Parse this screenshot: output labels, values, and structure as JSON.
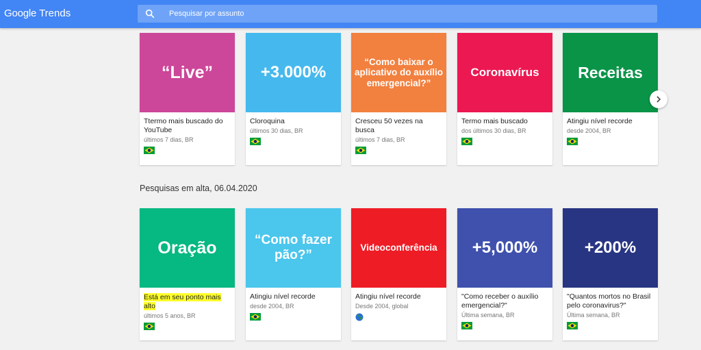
{
  "header": {
    "logo_google": "Google",
    "logo_trends": "Trends",
    "search_placeholder": "Pesquisar por assunto"
  },
  "year_in_search": {
    "cards": [
      {
        "tile_text": "“Live”",
        "color": "#cc4699",
        "description": "Ttermo mais buscado do YouTube",
        "meta": "últimos 7 dias, BR",
        "flag": "brazil-flag-icon"
      },
      {
        "tile_text": "+3.000%",
        "color": "#45b9ee",
        "description": "Cloroquina",
        "meta": "últimos 30 dias, BR",
        "flag": "brazil-flag-icon"
      },
      {
        "tile_text": "“Como baixar o aplicativo do auxílio emergencial?”",
        "color": "#f2803f",
        "description": "Cresceu 50 vezes na busca",
        "meta": "últimos 7 dias, BR",
        "flag": "brazil-flag-icon"
      },
      {
        "tile_text": "Coronavírus",
        "color": "#ec1852",
        "description": "Termo mais buscado",
        "meta": "dos últimos 30 dias, BR",
        "flag": "brazil-flag-icon"
      },
      {
        "tile_text": "Receitas",
        "color": "#0a9447",
        "description": "Atingiu nível recorde",
        "meta": "desde 2004, BR",
        "flag": "brazil-flag-icon"
      }
    ]
  },
  "trending": {
    "title": "Pesquisas em alta, 06.04.2020",
    "cards": [
      {
        "tile_text": "Oração",
        "color": "#06b881",
        "description": "Está em seu ponto mais alto",
        "meta": "últimos 5 anos, BR",
        "flag": "brazil-flag-icon",
        "highlighted": true
      },
      {
        "tile_text": "“Como fazer pão?”",
        "color": "#4bc6ec",
        "description": "Atingiu nível recorde",
        "meta": "desde 2004, BR",
        "flag": "brazil-flag-icon"
      },
      {
        "tile_text": "Videoconferência",
        "color": "#ee1c25",
        "description": "Atingiu nível recorde",
        "meta": "Desde 2004, global",
        "flag": "globe-icon"
      },
      {
        "tile_text": "+5,000%",
        "color": "#3f51ad",
        "description": "\"Como receber o auxílio emergencial?\"",
        "meta": "Última semana, BR",
        "flag": "brazil-flag-icon"
      },
      {
        "tile_text": "+200%",
        "color": "#283583",
        "description": "\"Quantos mortos no Brasil pelo coronavirus?\"",
        "meta": "Última semana, BR",
        "flag": "brazil-flag-icon"
      }
    ]
  },
  "icons": {
    "search": "search-icon",
    "next": "chevron-right-icon"
  }
}
